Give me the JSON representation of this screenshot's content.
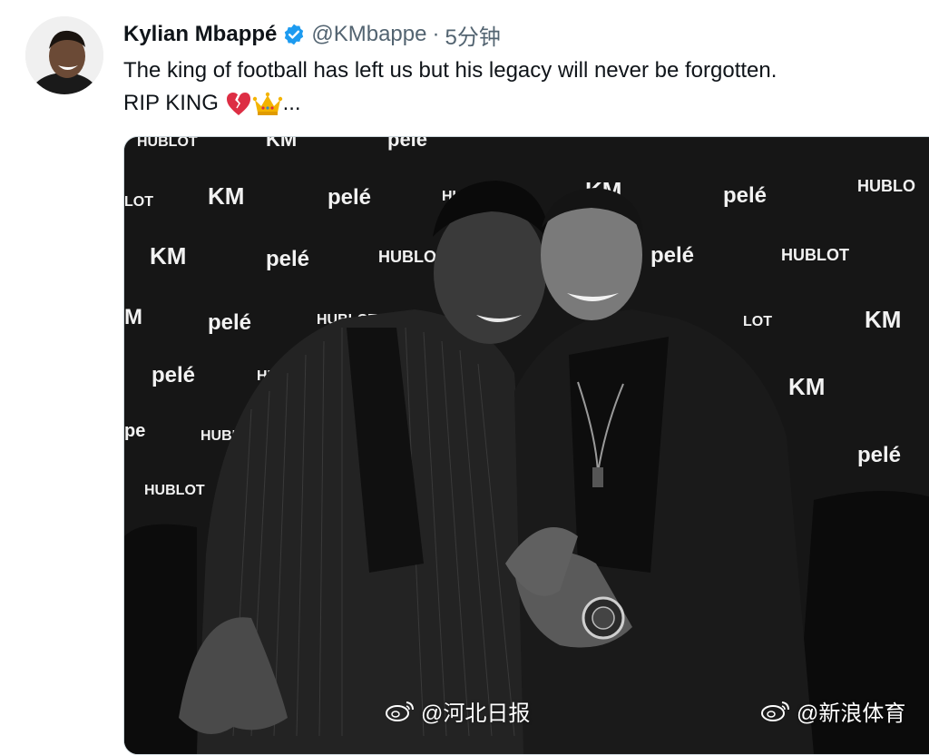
{
  "author": {
    "name": "Kylian Mbappé",
    "handle": "@KMbappe",
    "separator": "·",
    "time": "5分钟"
  },
  "tweet": {
    "line1": "The king of football has left us but his legacy will never be forgotten.",
    "line2_text": "RIP KING",
    "line2_suffix": "...",
    "emojis": [
      "broken-heart-emoji",
      "crown-emoji"
    ]
  },
  "media": {
    "backdrop_logos": [
      "HUBLOT",
      "KM",
      "pelé"
    ]
  },
  "watermarks": {
    "left": "@河北日报",
    "right": "@新浪体育"
  },
  "colors": {
    "verified": "#1d9bf0",
    "handle": "#536471",
    "text": "#0f1419"
  }
}
